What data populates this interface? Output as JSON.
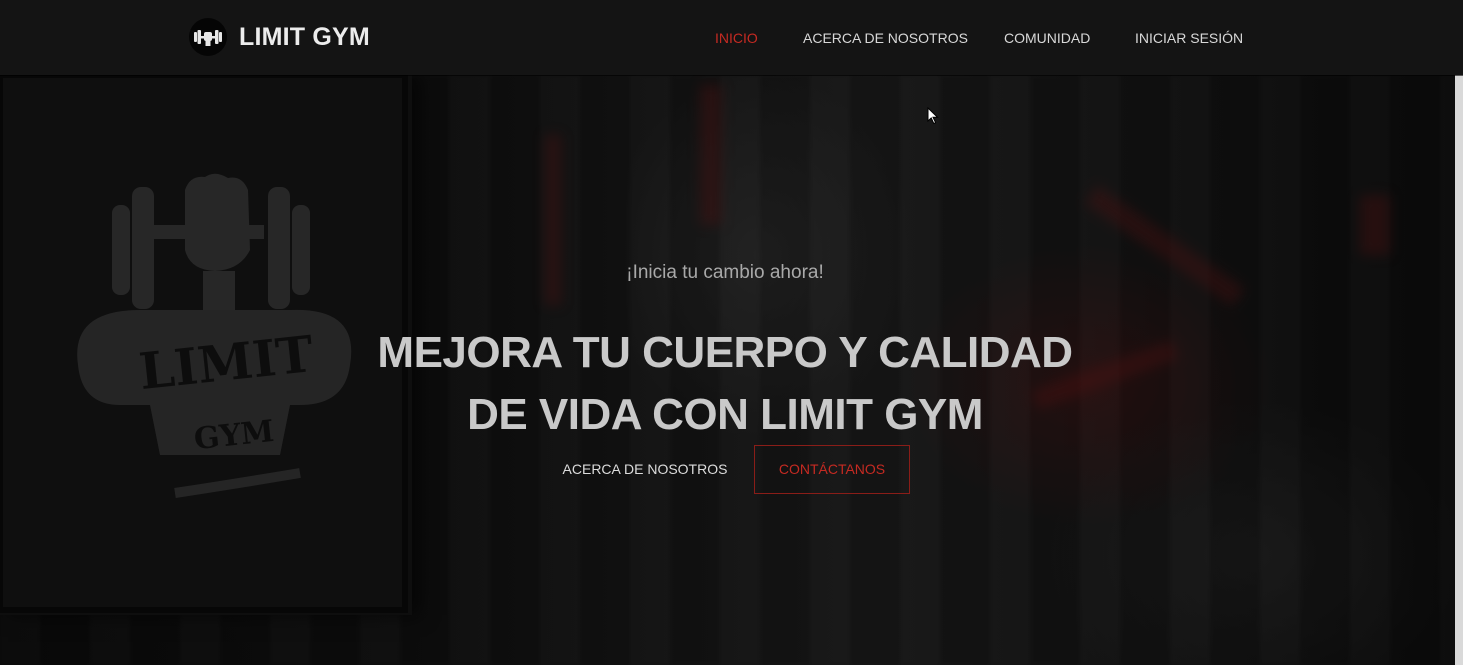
{
  "brand": {
    "name": "LIMIT GYM",
    "logo_icon": "dumbbell-logo-icon"
  },
  "nav": {
    "items": [
      {
        "label": "INICIO",
        "active": true
      },
      {
        "label": "ACERCA DE NOSOTROS",
        "active": false
      },
      {
        "label": "COMUNIDAD",
        "active": false
      },
      {
        "label": "INICIAR SESIÓN",
        "active": false
      }
    ]
  },
  "hero": {
    "tagline": "¡Inicia tu cambio ahora!",
    "headline_line1": "MEJORA TU CUERPO Y CALIDAD",
    "headline_line2": "DE VIDA CON LIMIT GYM",
    "primary_button": "ACERCA DE NOSOTROS",
    "secondary_button": "CONTÁCTANOS",
    "poster": {
      "line1": "LIMIT",
      "line2": "GYM",
      "icon": "fist-dumbbell-icon"
    }
  },
  "colors": {
    "accent": "#c52a22",
    "navbar_bg": "#141414",
    "text_light": "#d8d8d8"
  }
}
